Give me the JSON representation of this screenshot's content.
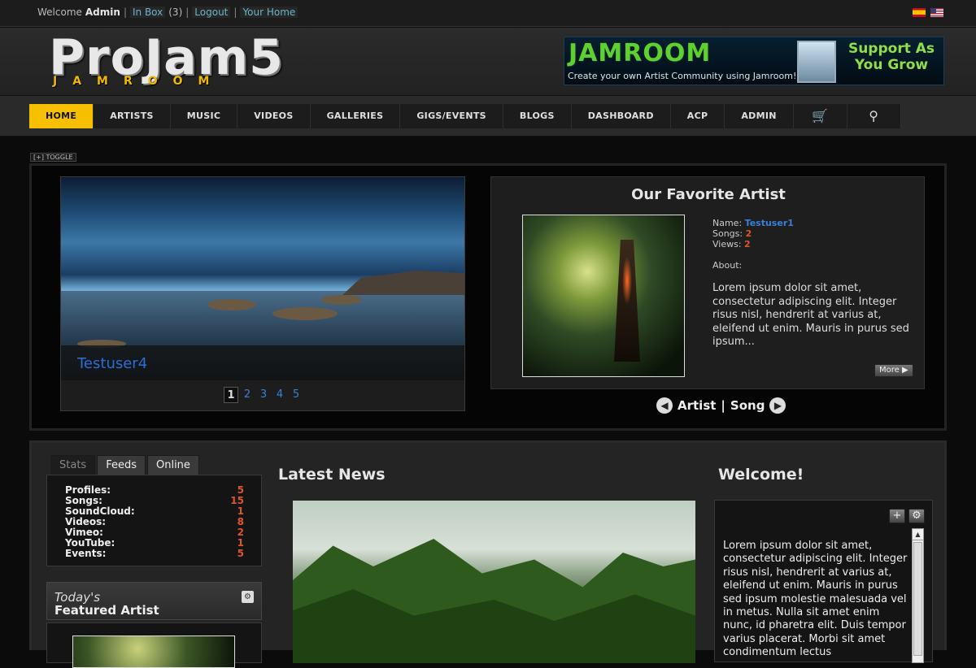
{
  "topbar": {
    "welcome": "Welcome",
    "user": "Admin",
    "inbox": "In Box",
    "inbox_count": "(3)",
    "logout": "Logout",
    "home": "Your Home"
  },
  "logo": {
    "main": "ProJam5",
    "sub": "JAMROOM"
  },
  "banner": {
    "brand": "JAMROOM",
    "tagline": "Create your own Artist Community using Jamroom!",
    "support": "Support As You Grow"
  },
  "nav": {
    "items": [
      "HOME",
      "ARTISTS",
      "MUSIC",
      "VIDEOS",
      "GALLERIES",
      "GIGS/EVENTS",
      "BLOGS",
      "DASHBOARD",
      "ACP",
      "ADMIN"
    ],
    "cart_icon": "cart-icon",
    "search_icon": "search-icon"
  },
  "toggle": "[+] TOGGLE",
  "slider": {
    "caption": "Testuser4",
    "pages": [
      "1",
      "2",
      "3",
      "4",
      "5"
    ],
    "current_page": "1"
  },
  "favorite": {
    "title": "Our Favorite Artist",
    "name_label": "Name:",
    "name": "Testuser1",
    "songs_label": "Songs:",
    "songs": "2",
    "views_label": "Views:",
    "views": "2",
    "about_label": "About:",
    "about": "Lorem ipsum dolor sit amet, consectetur adipiscing elit. Integer risus nisl, hendrerit at varius at, eleifend ut enim. Mauris in purus sed ipsum...",
    "more": "More",
    "switch_artist": "Artist",
    "switch_sep": "|",
    "switch_song": "Song"
  },
  "tabs": [
    "Stats",
    "Feeds",
    "Online"
  ],
  "stats": [
    {
      "label": "Profiles:",
      "value": "5"
    },
    {
      "label": "Songs:",
      "value": "15"
    },
    {
      "label": "SoundCloud:",
      "value": "1"
    },
    {
      "label": "Videos:",
      "value": "8"
    },
    {
      "label": "Vimeo:",
      "value": "2"
    },
    {
      "label": "YouTube:",
      "value": "1"
    },
    {
      "label": "Events:",
      "value": "5"
    }
  ],
  "today": {
    "line1": "Today's",
    "line2": "Featured Artist"
  },
  "news": {
    "title": "Latest News"
  },
  "welcome": {
    "title": "Welcome!",
    "text": "Lorem ipsum dolor sit amet, consectetur adipiscing elit. Integer risus nisl, hendrerit at varius at, eleifend ut enim. Mauris in purus sed ipsum molestie malesuada vel in metus. Nulla sit amet enim nunc, id pharetra elit. Duis tempor varius placerat. Morbi sit amet condimentum lectus"
  },
  "colors": {
    "accent": "#f6c000",
    "link": "#3b7fd9",
    "count": "#e0542a"
  }
}
